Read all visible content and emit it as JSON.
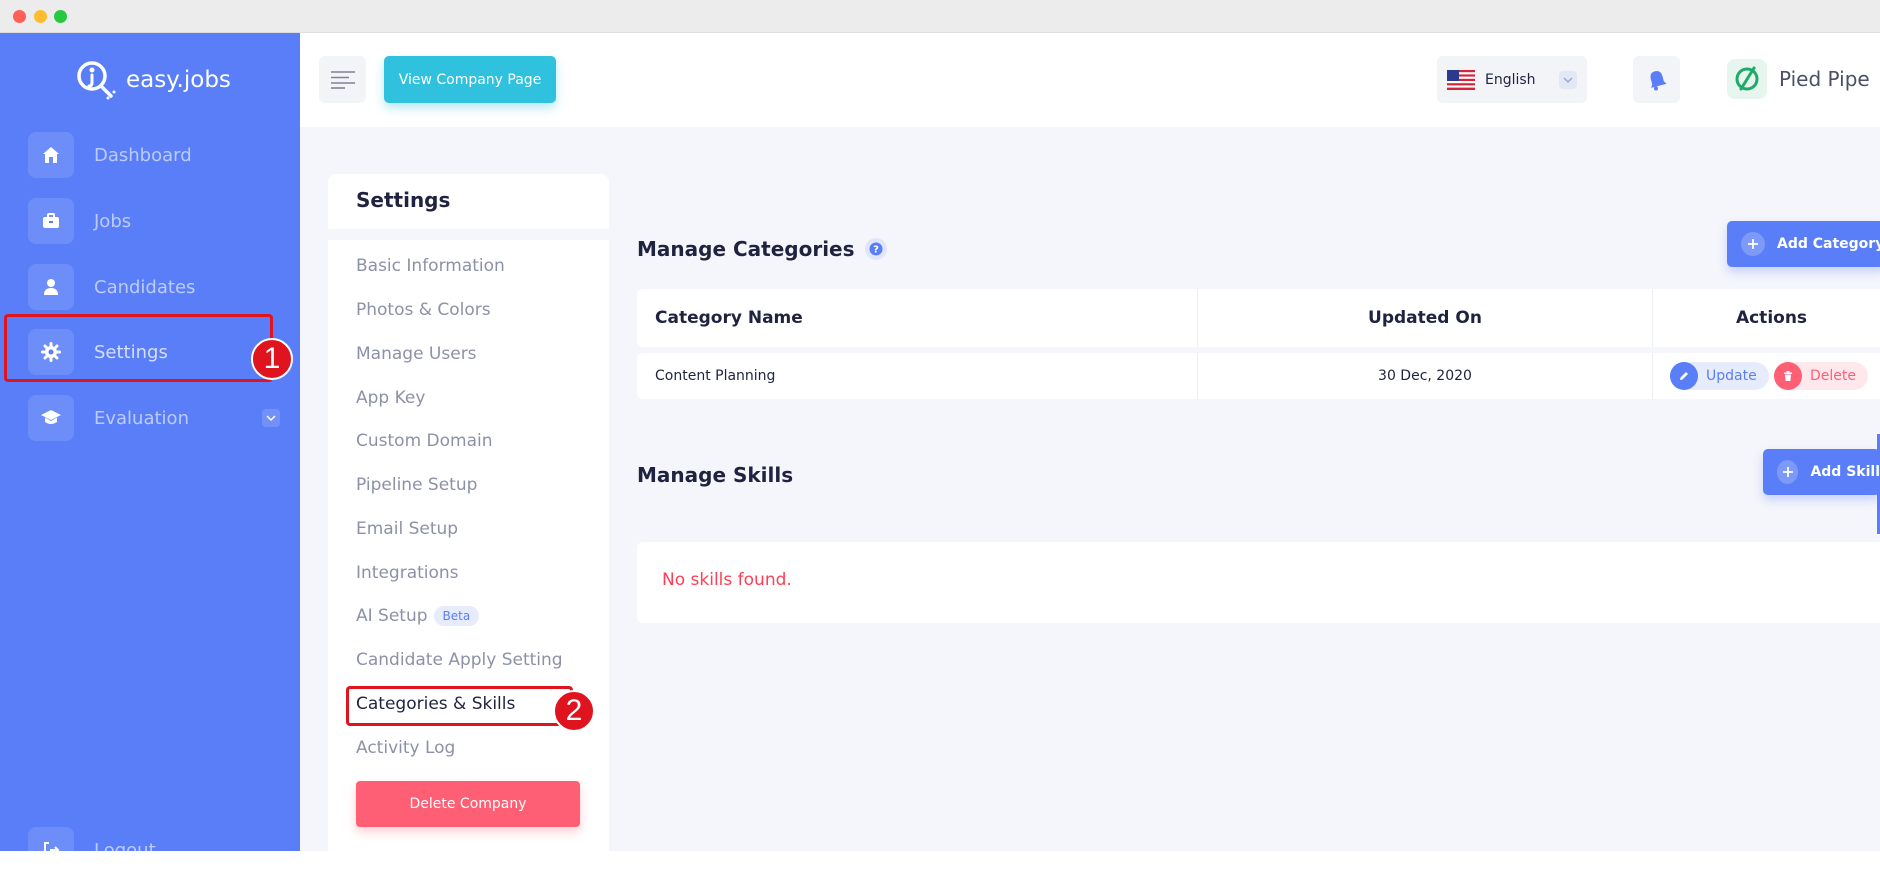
{
  "app": {
    "logo_text": "easy.jobs",
    "brand_name": "Pied Pipe"
  },
  "sidebar": {
    "items": [
      {
        "label": "Dashboard",
        "icon": "home-icon"
      },
      {
        "label": "Jobs",
        "icon": "briefcase-icon"
      },
      {
        "label": "Candidates",
        "icon": "user-icon"
      },
      {
        "label": "Settings",
        "icon": "gear-icon"
      },
      {
        "label": "Evaluation",
        "icon": "graduation-cap-icon"
      }
    ],
    "logout_label": "Logout"
  },
  "header": {
    "view_company_label": "View Company Page",
    "language": "English",
    "language_flag": "us-flag-icon",
    "notification_icon": "bell-icon"
  },
  "settings": {
    "title": "Settings",
    "items": [
      "Basic Information",
      "Photos & Colors",
      "Manage Users",
      "App Key",
      "Custom Domain",
      "Pipeline Setup",
      "Email Setup",
      "Integrations",
      "AI Setup",
      "Candidate Apply Setting",
      "Categories & Skills",
      "Activity Log"
    ],
    "beta_badge": "Beta",
    "delete_company_label": "Delete Company"
  },
  "annotations": {
    "badge_1": "1",
    "badge_2": "2"
  },
  "categories": {
    "title": "Manage Categories",
    "add_label": "Add Category",
    "columns": [
      "Category Name",
      "Updated On",
      "Actions"
    ],
    "rows": [
      {
        "name": "Content Planning",
        "updated_on": "30 Dec, 2020"
      }
    ],
    "update_label": "Update",
    "delete_label": "Delete"
  },
  "skills": {
    "title": "Manage Skills",
    "add_label": "Add Skill",
    "empty_text": "No skills found."
  },
  "colors": {
    "primary": "#597ef7",
    "accent": "#2fc1de",
    "danger": "#ff5f74",
    "annotation": "#e0141e"
  }
}
